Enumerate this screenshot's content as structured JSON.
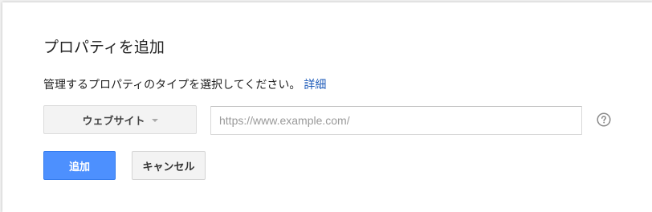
{
  "dialog": {
    "title": "プロパティを追加",
    "description": "管理するプロパティのタイプを選択してください。",
    "details_link": "詳細"
  },
  "form": {
    "type_select": {
      "selected": "ウェブサイト"
    },
    "url_input": {
      "value": "",
      "placeholder": "https://www.example.com/"
    },
    "help_icon": "help-circle-icon"
  },
  "actions": {
    "add_label": "追加",
    "cancel_label": "キャンセル"
  },
  "colors": {
    "primary_button": "#4d90fe",
    "link": "#1a58b8"
  }
}
